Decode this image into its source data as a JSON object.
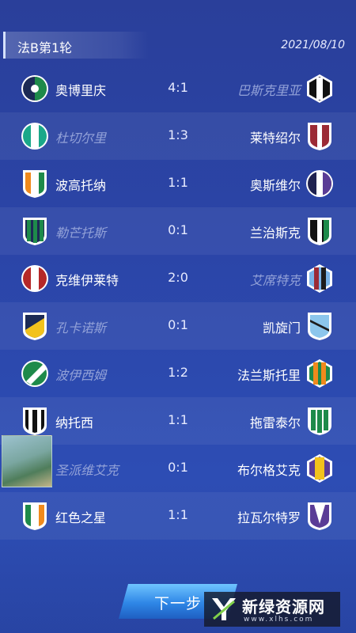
{
  "header": {
    "title": "法B第1轮",
    "date": "2021/08/10"
  },
  "matches": [
    {
      "home": "奥博里庆",
      "score": "4:1",
      "away": "巴斯克里亚",
      "home_badge": "crest-green-navy-icon",
      "away_badge": "crest-black-white-icon",
      "home_win": true
    },
    {
      "home": "杜切尔里",
      "score": "1:3",
      "away": "莱特绍尔",
      "home_badge": "crest-teal-white-icon",
      "away_badge": "crest-red-white-icon",
      "home_win": false
    },
    {
      "home": "波高托纳",
      "score": "1:1",
      "away": "奥斯维尔",
      "home_badge": "crest-orange-white-green-icon",
      "away_badge": "crest-purple-white-icon",
      "home_win": true
    },
    {
      "home": "勒芒托斯",
      "score": "0:1",
      "away": "兰治斯克",
      "home_badge": "crest-green-navy-stripes-icon",
      "away_badge": "crest-black-white-green-icon",
      "home_win": false
    },
    {
      "home": "克维伊莱特",
      "score": "2:0",
      "away": "艾席特克",
      "home_badge": "crest-red-white-icon",
      "away_badge": "crest-skyblue-red-icon",
      "home_win": true
    },
    {
      "home": "孔卡诺斯",
      "score": "0:1",
      "away": "凯旋门",
      "home_badge": "crest-navy-yellow-icon",
      "away_badge": "crest-skyblue-white-icon",
      "home_win": false
    },
    {
      "home": "波伊西姆",
      "score": "1:2",
      "away": "法兰斯托里",
      "home_badge": "crest-green-white-icon",
      "away_badge": "crest-orange-green-icon",
      "home_win": false
    },
    {
      "home": "纳托西",
      "score": "1:1",
      "away": "拖雷泰尔",
      "home_badge": "crest-black-white-stripes-icon",
      "away_badge": "crest-green-white-stripes-icon",
      "home_win": true
    },
    {
      "home": "圣派维艾克",
      "score": "0:1",
      "away": "布尔格艾克",
      "home_badge": "crest-white-purple-icon",
      "away_badge": "crest-yellow-purple-icon",
      "home_win": false
    },
    {
      "home": "红色之星",
      "score": "1:1",
      "away": "拉瓦尔特罗",
      "home_badge": "crest-green-white-orange-icon",
      "away_badge": "crest-purple-white-icon",
      "home_win": true
    }
  ],
  "next_button": {
    "label": "下一步"
  },
  "watermark": {
    "text": "新绿资源网",
    "url": "www.xlhs.com"
  },
  "colors": {
    "background": "#2b45a8",
    "win_text": "#ffffff",
    "lose_text": "#93a2d8",
    "button": "#2e86e6"
  }
}
